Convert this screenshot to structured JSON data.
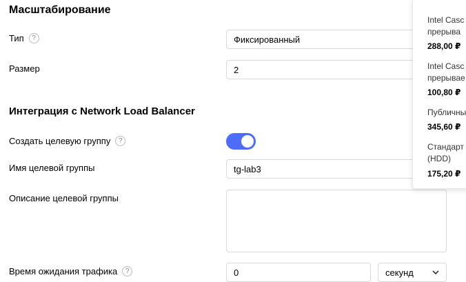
{
  "scaling": {
    "title": "Масштабирование",
    "type_label": "Тип",
    "type_value": "Фиксированный",
    "size_label": "Размер",
    "size_value": "2"
  },
  "nlb": {
    "title": "Интеграция с Network Load Balancer",
    "create_group_label": "Создать целевую группу",
    "create_group_enabled": true,
    "group_name_label": "Имя целевой группы",
    "group_name_value": "tg-lab3",
    "group_desc_label": "Описание целевой группы",
    "group_desc_value": "",
    "traffic_wait_label": "Время ожидания трафика",
    "traffic_wait_value": "0",
    "traffic_wait_unit": "секунд"
  },
  "help_glyph": "?",
  "pricing": {
    "items": [
      {
        "line1": "Intel Casc",
        "line2": "прерыва",
        "price": "288,00 ₽"
      },
      {
        "line1": "Intel Casc",
        "line2": "прерывае",
        "price": "100,80 ₽"
      },
      {
        "line1": "Публичны",
        "price": "345,60 ₽"
      },
      {
        "line1": "Стандарт",
        "line2": "(HDD)",
        "price": "175,20 ₽"
      }
    ]
  }
}
